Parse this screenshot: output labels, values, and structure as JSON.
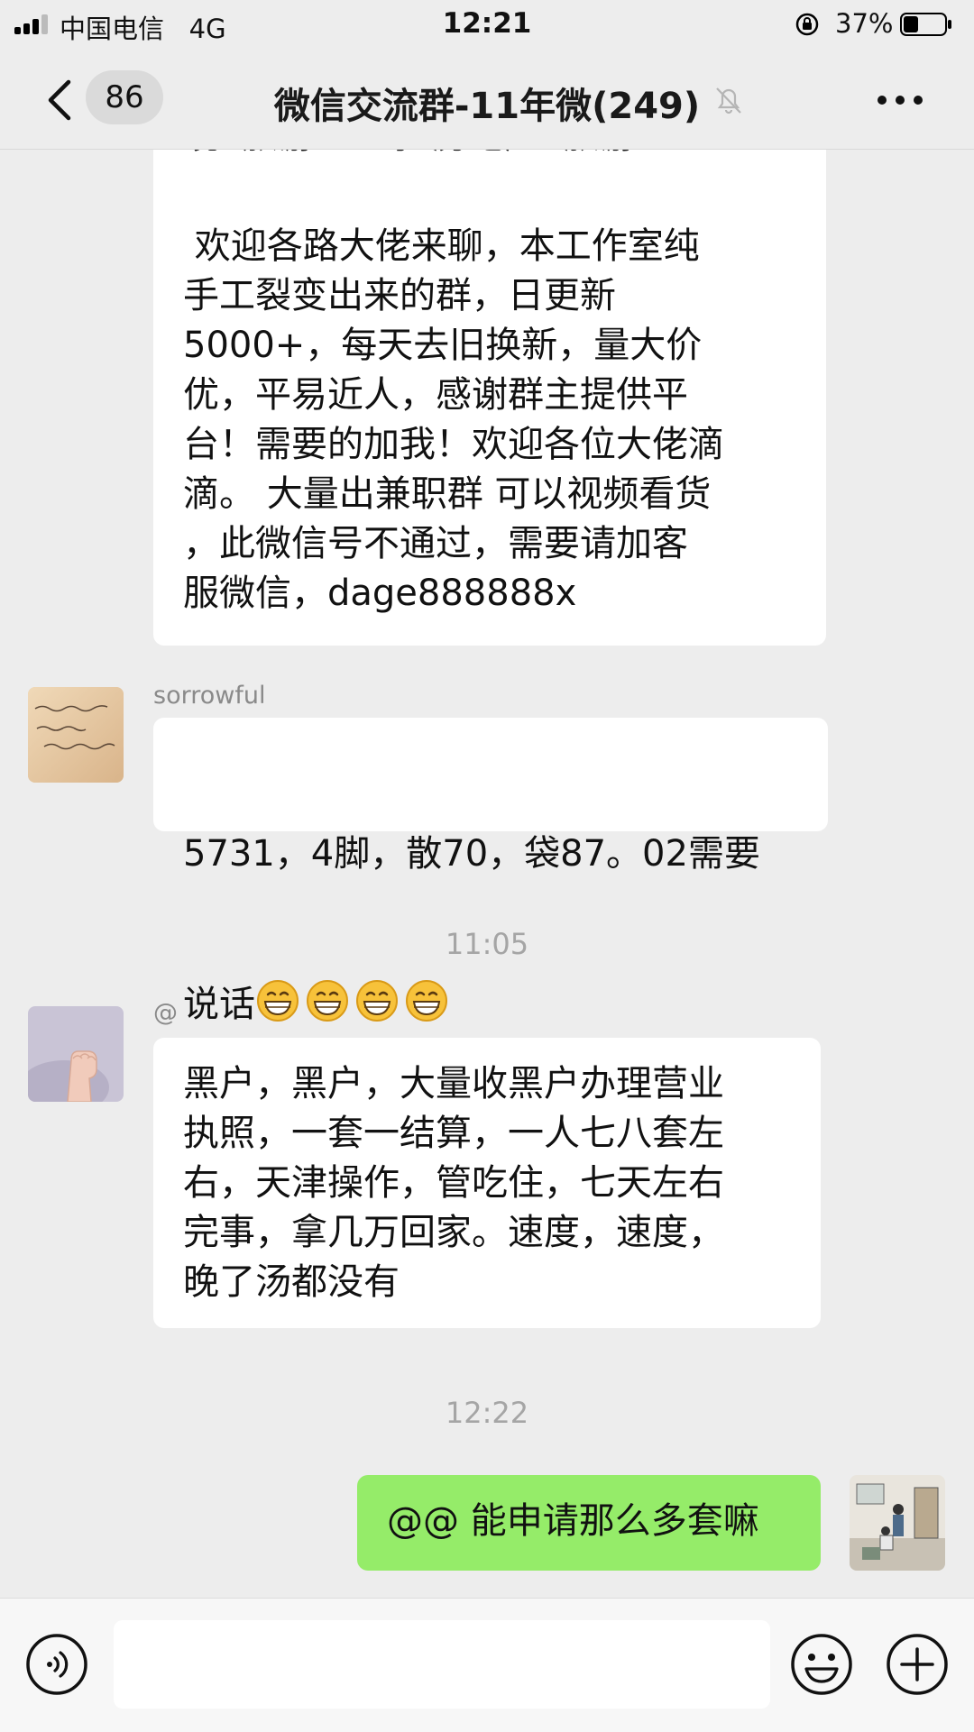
{
  "status_bar": {
    "carrier": "中国电信",
    "network": "4G",
    "time": "12:21",
    "battery_percent": "37%",
    "battery_level": 0.37
  },
  "nav": {
    "unread_count": "86",
    "title": "微信交流群-11年微(249)",
    "icons": [
      "back-arrow-icon",
      "mute-bell-icon",
      "more-dots-icon"
    ]
  },
  "messages": [
    {
      "type": "incoming",
      "cut_line": "境  旅游  医药  房地产  旅游",
      "text": " 欢迎各路大佬来聊，本工作室纯\n手工裂变出来的群，日更新\n5000+，每天去旧换新，量大价\n优，平易近人，感谢群主提供平\n台！需要的加我！欢迎各位大佬滴\n滴。 大量出兼职群 可以视频看货\n，此微信号不通过，需要请加客\n服微信，dage888888x"
    },
    {
      "type": "incoming",
      "sender": "sorrowful",
      "avatar": "handwriting-note-avatar",
      "text_line1": "5731，4脚，散70，袋87。02需要",
      "text_line2": "说话",
      "emoji": [
        "grin-emoji",
        "grin-emoji",
        "grin-emoji",
        "grin-emoji"
      ]
    },
    {
      "type": "time",
      "text": "11:05"
    },
    {
      "type": "incoming",
      "sender": "@",
      "avatar": "baby-fist-avatar",
      "text": "黑户，黑户，大量收黑户办理营业\n执照，一套一结算，一人七八套左\n右，天津操作，管吃住，七天左右\n完事，拿几万回家。速度，速度，\n晚了汤都没有"
    },
    {
      "type": "time",
      "text": "12:22"
    },
    {
      "type": "outgoing",
      "avatar": "illustrated-room-avatar",
      "text": "@@ 能申请那么多套嘛"
    }
  ],
  "input_bar": {
    "icons": [
      "voice-icon",
      "emoji-icon",
      "plus-icon"
    ],
    "placeholder": ""
  },
  "colors": {
    "background": "#ededed",
    "incoming_bubble": "#ffffff",
    "outgoing_bubble": "#95ec69",
    "timestamp": "#a5a5a5",
    "sender_name": "#8a8a8a"
  }
}
